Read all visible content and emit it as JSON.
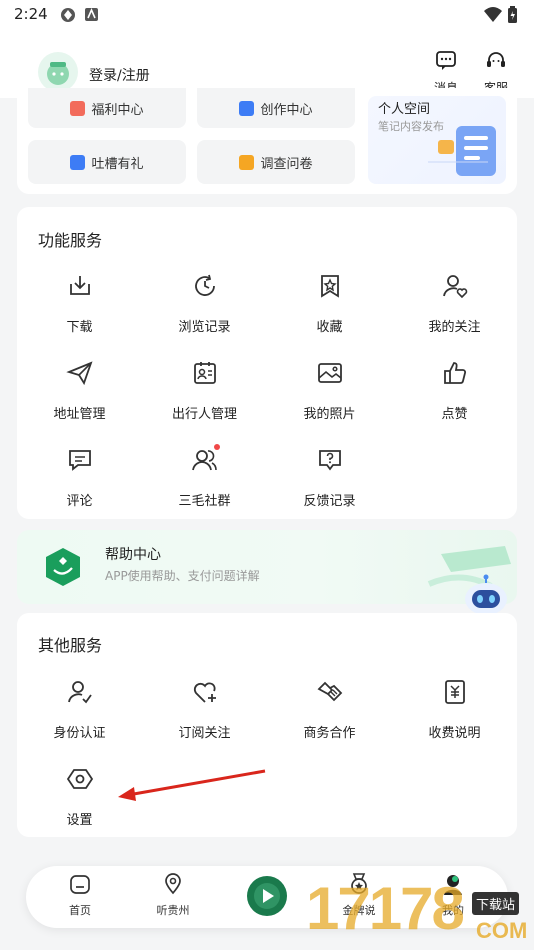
{
  "status_bar": {
    "time": "2:24"
  },
  "header": {
    "login_label": "登录/注册",
    "message_label": "消息",
    "service_label": "客服"
  },
  "quick": {
    "items": [
      {
        "label": "福利中心",
        "color": "#f26b5b"
      },
      {
        "label": "创作中心",
        "color": "#3d7cf5"
      },
      {
        "label": "吐槽有礼",
        "color": "#3d7cf5"
      },
      {
        "label": "调查问卷",
        "color": "#f5a623"
      }
    ],
    "space_title": "个人空间",
    "space_subtitle": "笔记内容发布"
  },
  "functions": {
    "title": "功能服务",
    "items": [
      {
        "label": "下载",
        "icon": "download-icon",
        "badge": false
      },
      {
        "label": "浏览记录",
        "icon": "history-icon",
        "badge": false
      },
      {
        "label": "收藏",
        "icon": "favorite-icon",
        "badge": false
      },
      {
        "label": "我的关注",
        "icon": "follow-icon",
        "badge": false
      },
      {
        "label": "地址管理",
        "icon": "address-icon",
        "badge": false
      },
      {
        "label": "出行人管理",
        "icon": "traveler-icon",
        "badge": false
      },
      {
        "label": "我的照片",
        "icon": "photo-icon",
        "badge": false
      },
      {
        "label": "点赞",
        "icon": "like-icon",
        "badge": false
      },
      {
        "label": "评论",
        "icon": "comment-icon",
        "badge": false
      },
      {
        "label": "三毛社群",
        "icon": "community-icon",
        "badge": true
      },
      {
        "label": "反馈记录",
        "icon": "feedback-icon",
        "badge": false
      }
    ]
  },
  "help": {
    "title": "帮助中心",
    "subtitle": "APP使用帮助、支付问题详解"
  },
  "other": {
    "title": "其他服务",
    "items": [
      {
        "label": "身份认证",
        "icon": "identity-icon"
      },
      {
        "label": "订阅关注",
        "icon": "subscribe-icon"
      },
      {
        "label": "商务合作",
        "icon": "handshake-icon"
      },
      {
        "label": "收费说明",
        "icon": "fee-icon"
      },
      {
        "label": "设置",
        "icon": "settings-icon"
      }
    ]
  },
  "tabbar": {
    "items": [
      {
        "label": "首页"
      },
      {
        "label": "听贵州"
      },
      {
        "label": ""
      },
      {
        "label": "金牌说"
      },
      {
        "label": "我的"
      }
    ]
  },
  "watermark": {
    "text": "17178",
    "tag": "下载站",
    "domain": "COM"
  },
  "colors": {
    "accent": "#1a9e5c",
    "annotation_arrow": "#d9261c",
    "badge": "#f04848"
  }
}
